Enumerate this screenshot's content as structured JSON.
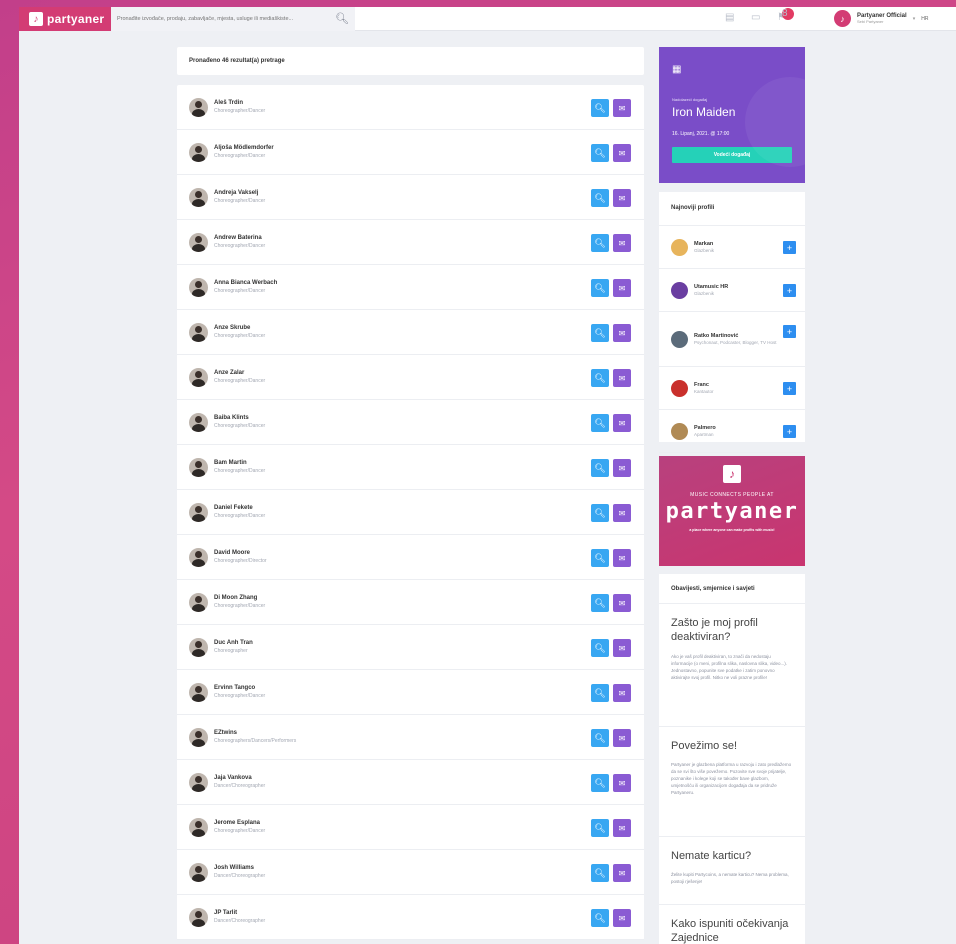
{
  "brand": {
    "name": "partyaner"
  },
  "search": {
    "placeholder": "Pronađite izvođače, prodaju, zabavljače, mjesta, usluge ili mediaškiste..."
  },
  "header": {
    "notification_count": "8",
    "user_name": "Partyaner Official",
    "user_sub": "Sebi Partyaner",
    "language": "HR"
  },
  "results": {
    "summary": "Pronađeno 46 rezultat(a) pretrage",
    "items": [
      {
        "name": "Aleš Trdin",
        "role": "Choreographer/Dancer"
      },
      {
        "name": "Aljoša Mödlemdorfer",
        "role": "Choreographer/Dancer"
      },
      {
        "name": "Andreja Vakselj",
        "role": "Choreographer/Dancer"
      },
      {
        "name": "Andrew Baterina",
        "role": "Choreographer/Dancer"
      },
      {
        "name": "Anna Bianca Werbach",
        "role": "Choreographer/Dancer"
      },
      {
        "name": "Anze Skrube",
        "role": "Choreographer/Dancer"
      },
      {
        "name": "Anze Zalar",
        "role": "Choreographer/Dancer"
      },
      {
        "name": "Baiba Klints",
        "role": "Choreographer/Dancer"
      },
      {
        "name": "Bam Martin",
        "role": "Choreographer/Dancer"
      },
      {
        "name": "Daniel Fekete",
        "role": "Choreographer/Dancer"
      },
      {
        "name": "David Moore",
        "role": "Choreographer/Director"
      },
      {
        "name": "Di Moon Zhang",
        "role": "Choreographer/Dancer"
      },
      {
        "name": "Duc Anh Tran",
        "role": "Choreographer"
      },
      {
        "name": "Ervinn Tangco",
        "role": "Choreographer/Dancer"
      },
      {
        "name": "EZtwins",
        "role": "Choreographers/Dancers/Performers"
      },
      {
        "name": "Jaja Vankova",
        "role": "Dancer/Choreographer"
      },
      {
        "name": "Jerome Esplana",
        "role": "Choreographer/Dancer"
      },
      {
        "name": "Josh Williams",
        "role": "Dancer/Choreographer"
      },
      {
        "name": "JP Tarlit",
        "role": "Dancer/Choreographer"
      }
    ]
  },
  "event": {
    "label": "Nadolazeći događaj",
    "title": "Iron Maiden",
    "date": "16. Lipanj, 2021. @ 17:00",
    "cta": "Vodeći događaj"
  },
  "newest": {
    "heading": "Najnoviji profili",
    "items": [
      {
        "name": "Markan",
        "role": "Glazbenik"
      },
      {
        "name": "Utamusic HR",
        "role": "Glazbenik"
      },
      {
        "name": "Ratko Martinović",
        "role": "Psychonaut, Podcaster, Blogger, TV Host"
      },
      {
        "name": "Franc",
        "role": "Kantautor"
      },
      {
        "name": "Palmero",
        "role": "Apartman"
      }
    ]
  },
  "banner": {
    "tagline": "MUSIC CONNECTS PEOPLE AT",
    "name": "partyaner",
    "sub": "a place where anyone can make profits with music!"
  },
  "tips": {
    "heading": "Obavijesti, smjernice i savjeti",
    "items": [
      {
        "title": "Zašto je moj profil deaktiviran?",
        "body": "Ako je vaš profil deaktiviran, to znači da nedostaju informacije (o meni, profilna slika, naslovna slika, video...). Jednostavno, popunite sve podatke i zatim ponovno aktivirajte svoj profil. Nitko ne voli prazne profile!"
      },
      {
        "title": "Povežimo se!",
        "body": "Partyaner je glazbena platforma u razvoju i zato predlažemo da se svi što više povežemo. Pozovite sve svoje prijatelje, poznanike i kolege koji se također bave glazbom, umjetnošću ili organizacijom događaja da se pridruže Partyaneru."
      },
      {
        "title": "Nemate karticu?",
        "body": "Želite kupiti Partycoins, a nemate karticu? Nema problema, postoji rješenje!"
      },
      {
        "title": "Kako ispuniti očekivanja Zajednice",
        "body": ""
      }
    ]
  }
}
